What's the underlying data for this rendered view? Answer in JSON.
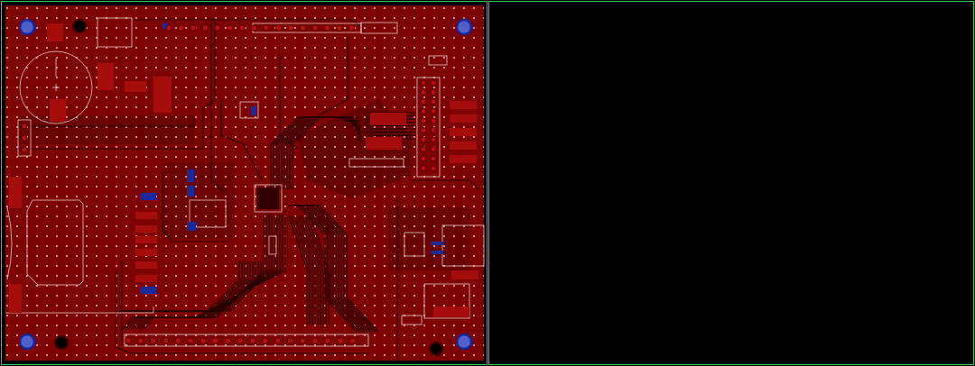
{
  "view": {
    "kind": "pcb-layout"
  }
}
